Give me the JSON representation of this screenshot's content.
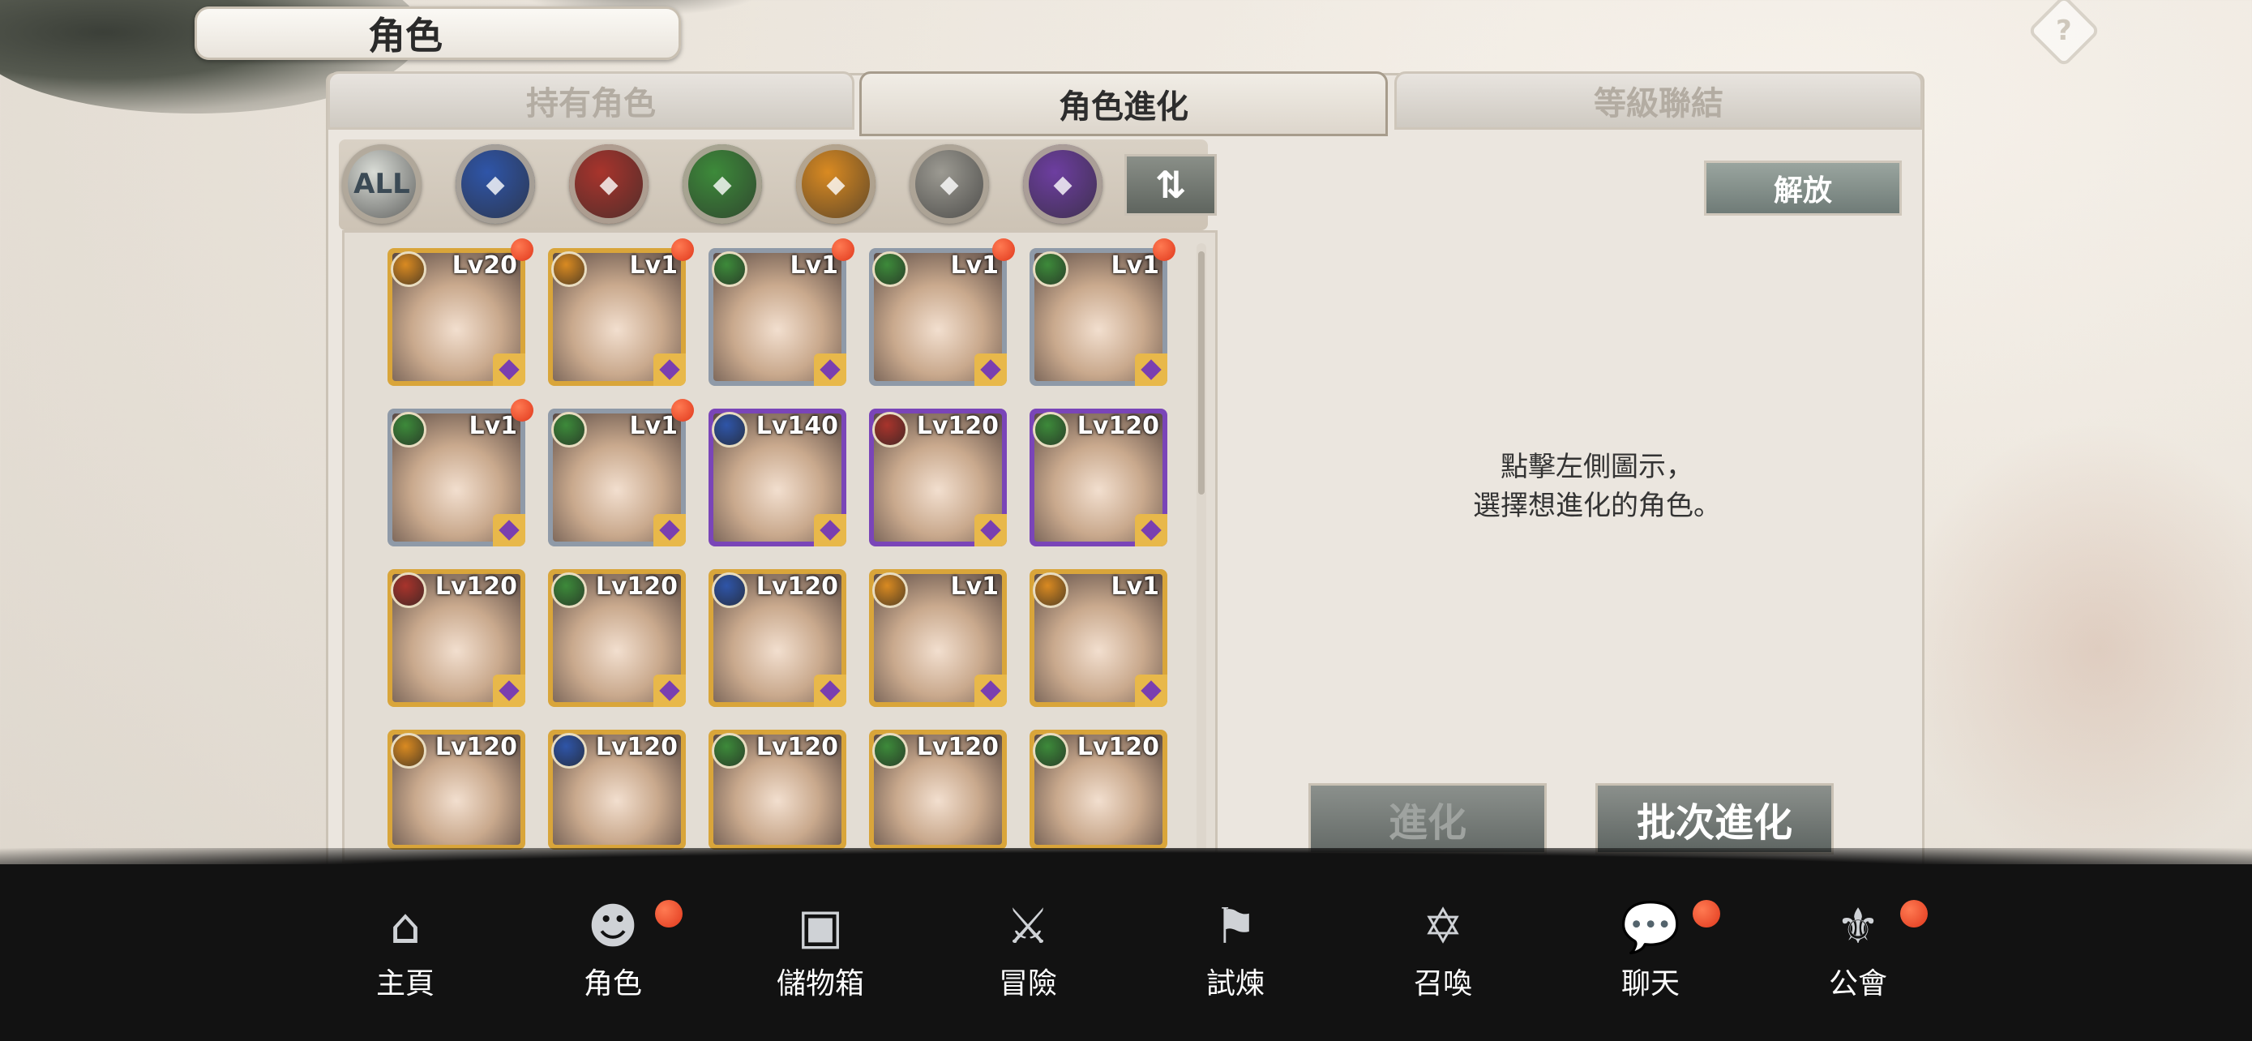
{
  "header": {
    "title": "角色"
  },
  "tabs": [
    {
      "label": "持有角色",
      "active": false
    },
    {
      "label": "角色進化",
      "active": true
    },
    {
      "label": "等級聯結",
      "active": false
    }
  ],
  "filters": {
    "all_label": "ALL",
    "elements": [
      {
        "name": "all",
        "color": "#d9dcd6"
      },
      {
        "name": "water",
        "color": "#2f55a8"
      },
      {
        "name": "fire",
        "color": "#a8342c"
      },
      {
        "name": "wind",
        "color": "#3d8a3a"
      },
      {
        "name": "light",
        "color": "#d98a22"
      },
      {
        "name": "neutral",
        "color": "#9c9a92"
      },
      {
        "name": "dark",
        "color": "#6d3ea0"
      }
    ],
    "sort_icon": "sort-icon"
  },
  "characters": [
    {
      "level": "Lv20",
      "element": "light",
      "frame": "gold",
      "new": true
    },
    {
      "level": "Lv1",
      "element": "light",
      "frame": "gold",
      "new": true
    },
    {
      "level": "Lv1",
      "element": "wind",
      "frame": "silver",
      "new": true
    },
    {
      "level": "Lv1",
      "element": "wind",
      "frame": "silver",
      "new": true
    },
    {
      "level": "Lv1",
      "element": "wind",
      "frame": "silver",
      "new": true
    },
    {
      "level": "Lv1",
      "element": "wind",
      "frame": "silver",
      "new": true
    },
    {
      "level": "Lv1",
      "element": "wind",
      "frame": "silver",
      "new": true
    },
    {
      "level": "Lv140",
      "element": "water",
      "frame": "purple",
      "new": false
    },
    {
      "level": "Lv120",
      "element": "fire",
      "frame": "purple",
      "new": false
    },
    {
      "level": "Lv120",
      "element": "wind",
      "frame": "purple",
      "new": false
    },
    {
      "level": "Lv120",
      "element": "fire",
      "frame": "gold",
      "new": false
    },
    {
      "level": "Lv120",
      "element": "wind",
      "frame": "gold",
      "new": false
    },
    {
      "level": "Lv120",
      "element": "water",
      "frame": "gold",
      "new": false
    },
    {
      "level": "Lv1",
      "element": "light",
      "frame": "gold",
      "new": false
    },
    {
      "level": "Lv1",
      "element": "light",
      "frame": "gold",
      "new": false
    },
    {
      "level": "Lv120",
      "element": "light",
      "frame": "gold",
      "new": false
    },
    {
      "level": "Lv120",
      "element": "water",
      "frame": "gold",
      "new": false
    },
    {
      "level": "Lv120",
      "element": "wind",
      "frame": "gold",
      "new": false
    },
    {
      "level": "Lv120",
      "element": "wind",
      "frame": "gold",
      "new": false
    },
    {
      "level": "Lv120",
      "element": "wind",
      "frame": "gold",
      "new": false
    }
  ],
  "right_panel": {
    "unlock_label": "解放",
    "hint_line1": "點擊左側圖示，",
    "hint_line2": "選擇想進化的角色。",
    "evolve_label": "進化",
    "batch_evolve_label": "批次進化"
  },
  "bottom_nav": [
    {
      "label": "主頁",
      "icon": "home-icon",
      "badge": false
    },
    {
      "label": "角色",
      "icon": "characters-icon",
      "badge": true
    },
    {
      "label": "儲物箱",
      "icon": "storage-box-icon",
      "badge": false
    },
    {
      "label": "冒險",
      "icon": "crossed-swords-icon",
      "badge": false
    },
    {
      "label": "試煉",
      "icon": "flag-icon",
      "badge": false
    },
    {
      "label": "召喚",
      "icon": "summon-hexagram-icon",
      "badge": false
    },
    {
      "label": "聊天",
      "icon": "chat-icon",
      "badge": true
    },
    {
      "label": "公會",
      "icon": "guild-emblem-icon",
      "badge": true
    }
  ]
}
